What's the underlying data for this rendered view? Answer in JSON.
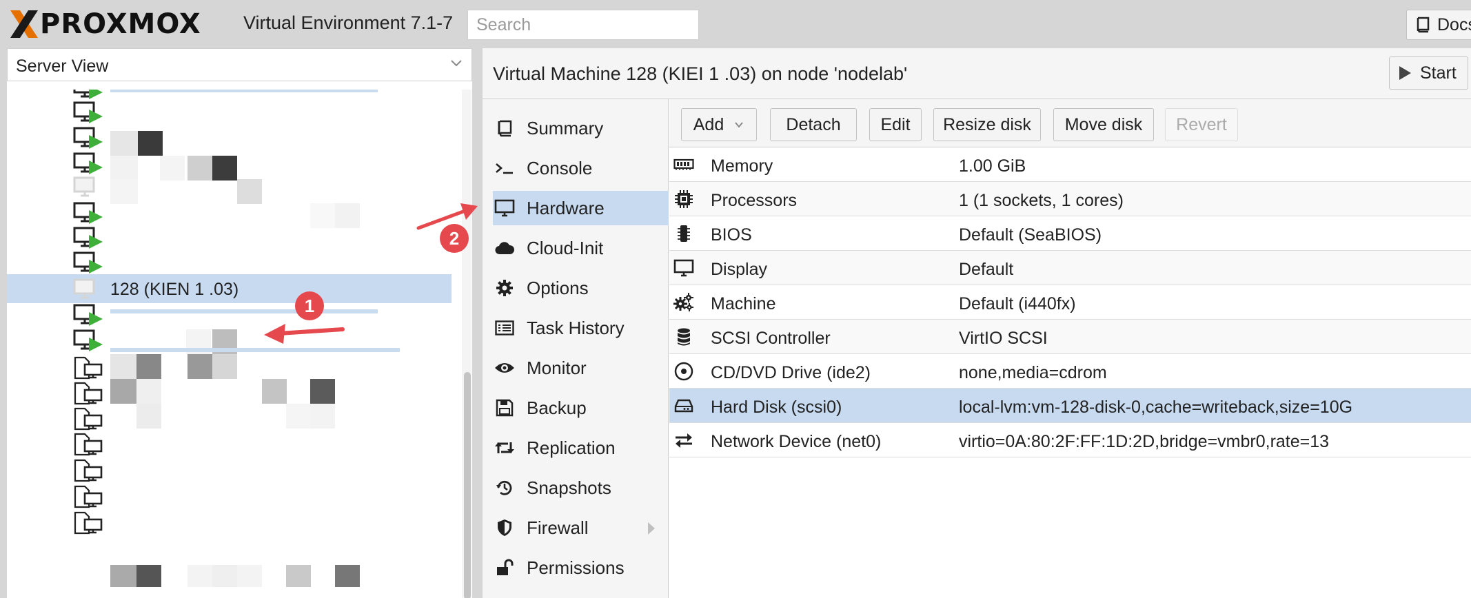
{
  "app": {
    "logo_text": "PROXMOX",
    "product": "Virtual Environment 7.1-7",
    "search_placeholder": "Search",
    "docs_label": "Docs"
  },
  "left_panel": {
    "view_selector": "Server View",
    "selected_vm_label": "128 (KIEN  1 .03)"
  },
  "vm": {
    "title": "Virtual Machine 128 (KIEI    1 .03) on node 'nodelab'",
    "start_label": "Start"
  },
  "nav": {
    "items": [
      {
        "label": "Summary",
        "icon": "book-icon"
      },
      {
        "label": "Console",
        "icon": "terminal-icon"
      },
      {
        "label": "Hardware",
        "icon": "monitor-icon"
      },
      {
        "label": "Cloud-Init",
        "icon": "cloud-icon"
      },
      {
        "label": "Options",
        "icon": "gear-icon"
      },
      {
        "label": "Task History",
        "icon": "list-icon"
      },
      {
        "label": "Monitor",
        "icon": "eye-icon"
      },
      {
        "label": "Backup",
        "icon": "floppy-icon"
      },
      {
        "label": "Replication",
        "icon": "retweet-icon"
      },
      {
        "label": "Snapshots",
        "icon": "history-icon"
      },
      {
        "label": "Firewall",
        "icon": "shield-icon"
      },
      {
        "label": "Permissions",
        "icon": "unlock-icon"
      }
    ],
    "active": "Hardware"
  },
  "toolbar": {
    "add": "Add",
    "detach": "Detach",
    "edit": "Edit",
    "resize": "Resize disk",
    "move": "Move disk",
    "revert": "Revert"
  },
  "hardware": [
    {
      "name": "Memory",
      "value": "1.00 GiB",
      "icon": "memory-icon"
    },
    {
      "name": "Processors",
      "value": "1 (1 sockets, 1 cores)",
      "icon": "cpu-icon"
    },
    {
      "name": "BIOS",
      "value": "Default (SeaBIOS)",
      "icon": "chip-icon"
    },
    {
      "name": "Display",
      "value": "Default",
      "icon": "desktop-icon"
    },
    {
      "name": "Machine",
      "value": "Default (i440fx)",
      "icon": "cogs-icon"
    },
    {
      "name": "SCSI Controller",
      "value": "VirtIO SCSI",
      "icon": "database-icon"
    },
    {
      "name": "CD/DVD Drive (ide2)",
      "value": "none,media=cdrom",
      "icon": "disc-icon"
    },
    {
      "name": "Hard Disk (scsi0)",
      "value": "local-lvm:vm-128-disk-0,cache=writeback,size=10G",
      "icon": "hdd-icon"
    },
    {
      "name": "Network Device (net0)",
      "value": "virtio=0A:80:2F:FF:1D:2D,bridge=vmbr0,rate=13",
      "icon": "exchange-icon"
    }
  ],
  "selected_hardware": "Hard Disk (scsi0)",
  "annotations": {
    "badge1": "1",
    "badge2": "2"
  },
  "colors": {
    "accent": "#e57000",
    "selection": "#c7daf0",
    "running": "#3fae3a",
    "annotation": "#e5484d"
  }
}
